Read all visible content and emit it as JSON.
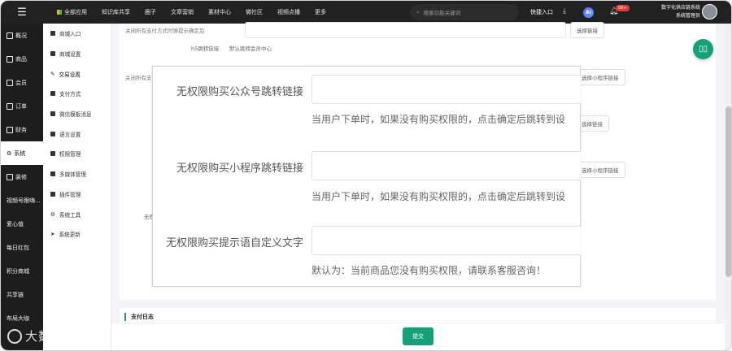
{
  "topbar": {
    "nav": [
      "全部应用",
      "知识库共享",
      "圈子",
      "文章营销",
      "素材中心",
      "微社区",
      "视频点播",
      "更多"
    ],
    "search_placeholder": "搜索功能关键词",
    "quick_entry": "快捷入口",
    "ai_label": "AI",
    "notification_badge": "99+",
    "user_line1": "数字化供应链系统",
    "user_line2": "系统管理员"
  },
  "sidebar": {
    "items": [
      {
        "label": "概况",
        "icon": "overview-icon"
      },
      {
        "label": "商品",
        "icon": "goods-icon"
      },
      {
        "label": "会员",
        "icon": "member-icon"
      },
      {
        "label": "订单",
        "icon": "order-icon"
      },
      {
        "label": "财务",
        "icon": "finance-icon"
      },
      {
        "label": "系统",
        "icon": "gear-icon",
        "active": true
      },
      {
        "label": "装修",
        "icon": "decor-icon"
      },
      {
        "label": "视频号跟嗨...",
        "icon": ""
      },
      {
        "label": "爱心值",
        "icon": ""
      },
      {
        "label": "每日红包",
        "icon": ""
      },
      {
        "label": "积分商城",
        "icon": ""
      },
      {
        "label": "共享链",
        "icon": ""
      },
      {
        "label": "布局大咖",
        "icon": ""
      }
    ]
  },
  "subnav": {
    "items": [
      {
        "label": "商城入口"
      },
      {
        "label": "商城设置"
      },
      {
        "label": "交易设置",
        "active": true
      },
      {
        "label": "支付方式"
      },
      {
        "label": "微信模板消息"
      },
      {
        "label": "语言设置"
      },
      {
        "label": "权限管理"
      },
      {
        "label": "多媒体管理"
      },
      {
        "label": "插件管理"
      },
      {
        "label": "系统工具"
      },
      {
        "label": "系统更新"
      }
    ]
  },
  "background": {
    "row1_text": "关闭所有支付方式时弹提示确定后",
    "row1_button": "选择链接",
    "h5_label": "h5跳转链接",
    "h5_value": "默认跳转会员中心",
    "row2_text": "关闭所有支",
    "row2_button": "选择小程序链接",
    "row3_button": "选择链接",
    "row4_button": "选择小程序链接",
    "partial_label": "无权"
  },
  "modal": {
    "fields": [
      {
        "label": "无权限购买公众号跳转链接",
        "hint": "当用户下单时，如果没有购买权限的，点击确定后跳转到设"
      },
      {
        "label": "无权限购买小程序跳转链接",
        "hint": "当用户下单时，如果没有购买权限的，点击确定后跳转到设"
      },
      {
        "label": "无权限购买提示语自定义文字",
        "hint": "默认为：当前商品您没有购买权限，请联系客服咨询！"
      }
    ]
  },
  "log": {
    "title": "支付日志"
  },
  "footer": {
    "submit_label": "提交"
  },
  "watermark": "大数跨境",
  "colors": {
    "accent": "#16a079",
    "topbar": "#212121",
    "sidebar": "#1d1d1d",
    "badge": "#e53935"
  }
}
